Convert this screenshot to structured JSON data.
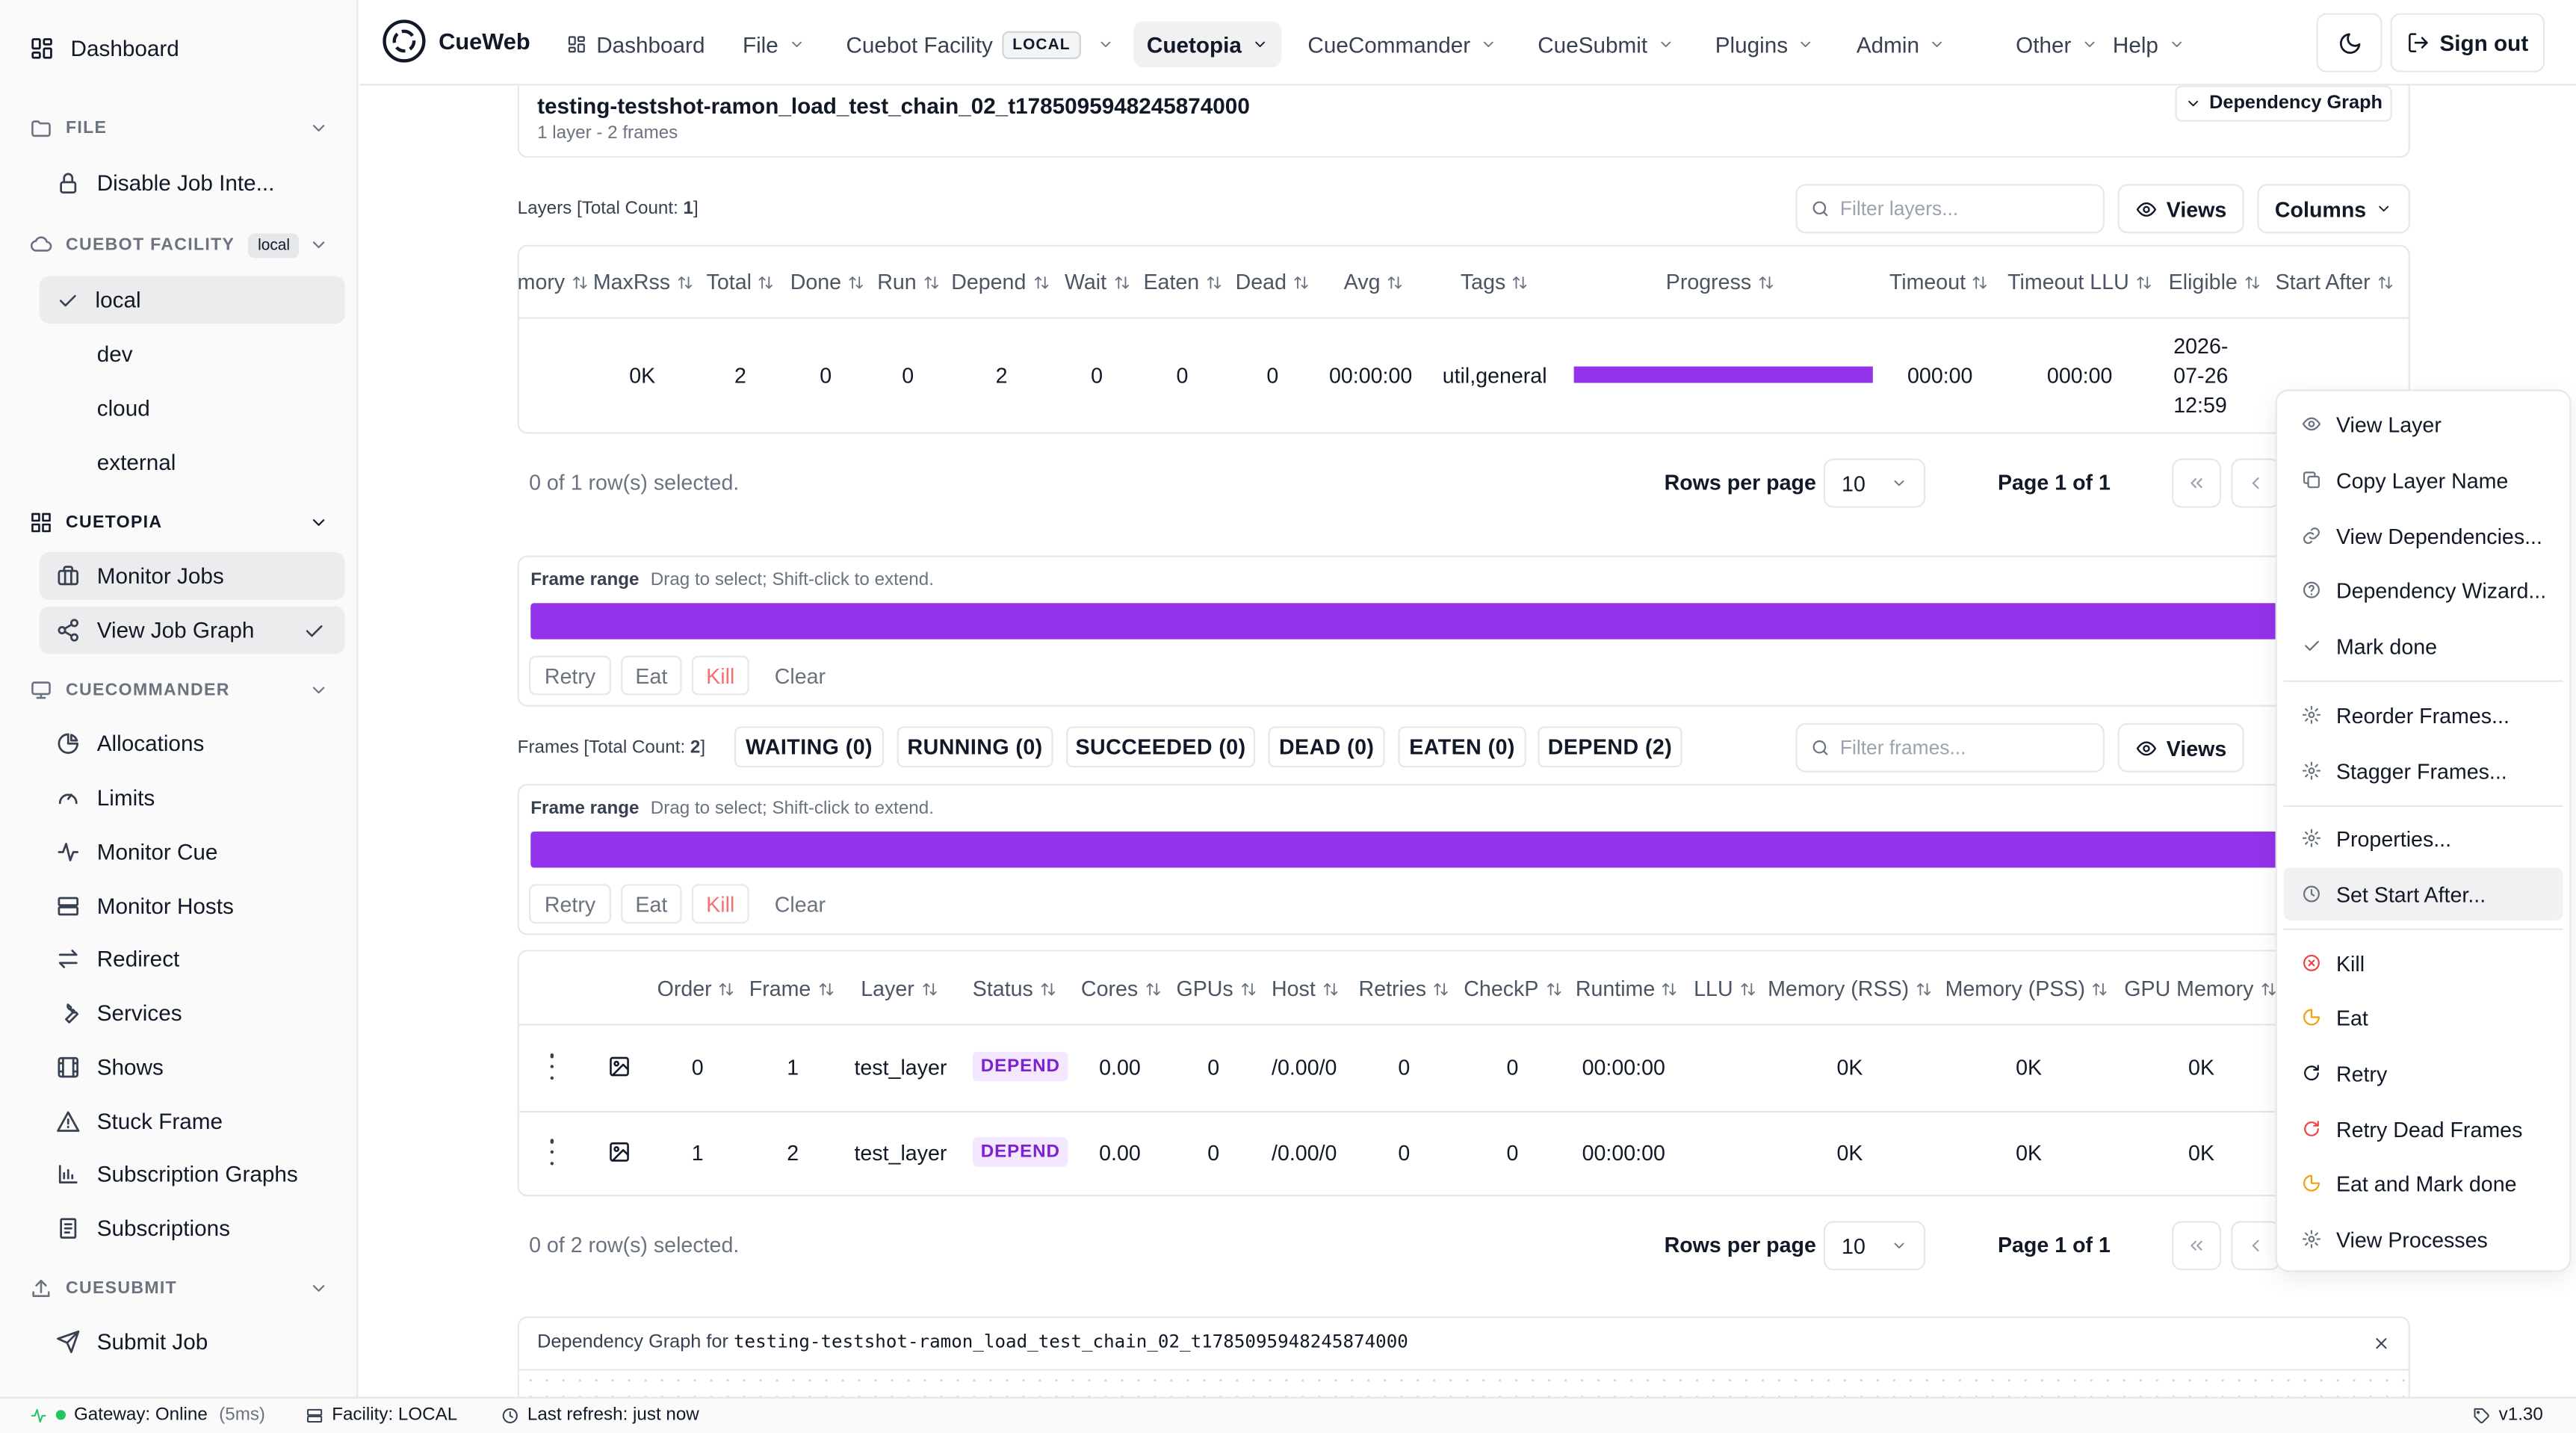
{
  "sidebar": {
    "dashboard": "Dashboard",
    "file": {
      "title": "FILE",
      "items": [
        "Disable Job Inte..."
      ]
    },
    "facility": {
      "title": "CUEBOT FACILITY",
      "badge": "local",
      "items": [
        "local",
        "dev",
        "cloud",
        "external"
      ],
      "active": "local"
    },
    "cuetopia": {
      "title": "CUETOPIA",
      "items": [
        "Monitor Jobs",
        "View Job Graph"
      ]
    },
    "cuecommander": {
      "title": "CUECOMMANDER",
      "items": [
        "Allocations",
        "Limits",
        "Monitor Cue",
        "Monitor Hosts",
        "Redirect",
        "Services",
        "Shows",
        "Stuck Frame",
        "Subscription Graphs",
        "Subscriptions"
      ]
    },
    "cuesubmit": {
      "title": "CUESUBMIT",
      "items": [
        "Submit Job"
      ]
    }
  },
  "nav": {
    "brand": "CueWeb",
    "items": [
      "Dashboard",
      "File",
      "Cuebot Facility",
      "Cuetopia",
      "CueCommander",
      "CueSubmit",
      "Plugins",
      "Admin",
      "Other",
      "Help"
    ],
    "facility_pill": "LOCAL",
    "sign_out": "Sign out"
  },
  "job": {
    "name": "testing-testshot-ramon_load_test_chain_02_t1785095948245874000",
    "summary": "1 layer - 2 frames",
    "dep_graph_button": "Dependency Graph"
  },
  "layers": {
    "title": "Layers [Total Count: ",
    "count": "1",
    "title_end": "]",
    "filter_placeholder": "Filter layers...",
    "views": "Views",
    "columns": "Columns",
    "headers": [
      "mory",
      "MaxRss",
      "Total",
      "Done",
      "Run",
      "Depend",
      "Wait",
      "Eaten",
      "Dead",
      "Avg",
      "Tags",
      "Progress",
      "Timeout",
      "Timeout LLU",
      "Eligible",
      "Start After"
    ],
    "row": {
      "memory": "",
      "maxrss": "0K",
      "total": "2",
      "done": "0",
      "run": "0",
      "depend": "2",
      "wait": "0",
      "eaten": "0",
      "dead": "0",
      "avg": "00:00:00",
      "tags": "util,general",
      "progress": 1.0,
      "timeout": "000:00",
      "timeout_llu": "000:00",
      "eligible": [
        "2026-",
        "07-26",
        "12:59"
      ],
      "start_after": ""
    },
    "selected": "0 of 1 row(s) selected.",
    "rows_per_page_label": "Rows per page",
    "rows_per_page": "10",
    "page": "Page 1 of 1"
  },
  "frame_range_1": {
    "label": "Frame range",
    "hint": "Drag to select; Shift-click to extend.",
    "buttons": [
      "Retry",
      "Eat",
      "Kill",
      "Clear"
    ]
  },
  "frames": {
    "title": "Frames [Total Count: ",
    "count": "2",
    "title_end": "]",
    "chips": [
      "WAITING (0)",
      "RUNNING (0)",
      "SUCCEEDED (0)",
      "DEAD (0)",
      "EATEN (0)",
      "DEPEND (2)"
    ],
    "filter_placeholder": "Filter frames...",
    "views": "Views",
    "headers": [
      "Order",
      "Frame",
      "Layer",
      "Status",
      "Cores",
      "GPUs",
      "Host",
      "Retries",
      "CheckP",
      "Runtime",
      "LLU",
      "Memory (RSS)",
      "Memory (PSS)",
      "GPU Memory"
    ],
    "rows": [
      {
        "order": "0",
        "frame": "1",
        "layer": "test_layer",
        "status": "DEPEND",
        "cores": "0.00",
        "gpus": "0",
        "host": "/0.00/0",
        "retries": "0",
        "checkp": "0",
        "runtime": "00:00:00",
        "llu": "",
        "rss": "0K",
        "pss": "0K",
        "gpu_mem": "0K"
      },
      {
        "order": "1",
        "frame": "2",
        "layer": "test_layer",
        "status": "DEPEND",
        "cores": "0.00",
        "gpus": "0",
        "host": "/0.00/0",
        "retries": "0",
        "checkp": "0",
        "runtime": "00:00:00",
        "llu": "",
        "rss": "0K",
        "pss": "0K",
        "gpu_mem": "0K"
      }
    ],
    "selected": "0 of 2 row(s) selected.",
    "rows_per_page_label": "Rows per page",
    "rows_per_page": "10",
    "page": "Page 1 of 1"
  },
  "frame_range_2": {
    "label": "Frame range",
    "hint": "Drag to select; Shift-click to extend.",
    "buttons": [
      "Retry",
      "Eat",
      "Kill",
      "Clear"
    ]
  },
  "dep_graph_panel": {
    "prefix": "Dependency Graph for ",
    "job": "testing-testshot-ramon_load_test_chain_02_t1785095948245874000"
  },
  "context_menu": {
    "items": [
      "View Layer",
      "Copy Layer Name",
      "View Dependencies...",
      "Dependency Wizard...",
      "Mark done",
      "Reorder Frames...",
      "Stagger Frames...",
      "Properties...",
      "Set Start After...",
      "Kill",
      "Eat",
      "Retry",
      "Retry Dead Frames",
      "Eat and Mark done",
      "View Processes"
    ],
    "highlighted": "Set Start After..."
  },
  "statusbar": {
    "gateway": "Gateway: Online",
    "latency": "(5ms)",
    "facility": "Facility: LOCAL",
    "refresh": "Last refresh: just now",
    "version": "v1.30"
  },
  "colors": {
    "accent_purple": "#9333ea",
    "depend_badge_bg": "#f3e8ff",
    "depend_badge_fg": "#7e22ce",
    "online_green": "#22c55e",
    "kill_red": "#ef4444",
    "eat_orange": "#f59e0b"
  }
}
